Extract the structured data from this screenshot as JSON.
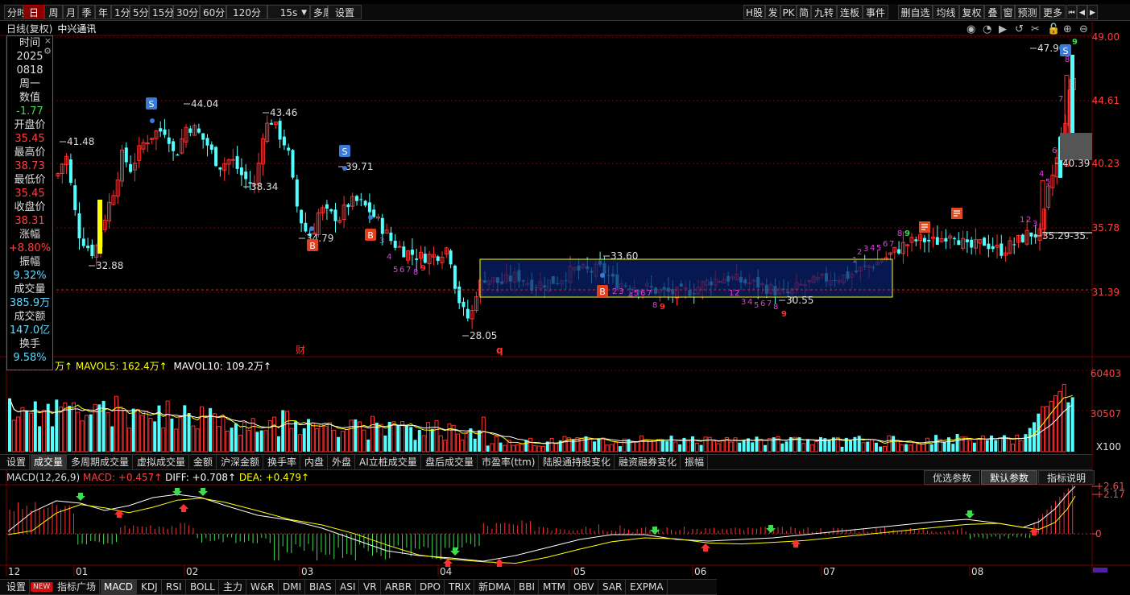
{
  "toolbar": {
    "left_items": [
      {
        "label": "分时",
        "active": false
      },
      {
        "label": "日",
        "active": true
      },
      {
        "label": "周",
        "active": false
      },
      {
        "label": "月",
        "active": false
      },
      {
        "label": "季",
        "active": false
      },
      {
        "label": "年",
        "active": false
      },
      {
        "label": "1分",
        "active": false
      },
      {
        "label": "5分",
        "active": false
      },
      {
        "label": "15分",
        "active": false
      },
      {
        "label": "30分",
        "active": false
      },
      {
        "label": "60分",
        "active": false
      },
      {
        "label": "120分",
        "active": false
      },
      {
        "label": "15s",
        "active": false
      },
      {
        "label": "多周期",
        "active": false
      },
      {
        "label": "设置",
        "active": false
      }
    ],
    "right_items": [
      "H股",
      "发",
      "PK",
      "简",
      "九转",
      "连板",
      "事件",
      "删自选",
      "均线",
      "复权",
      "叠",
      "窗",
      "预测",
      "更多"
    ]
  },
  "stock": {
    "period": "日线(复权)",
    "name": "中兴通讯"
  },
  "info_panel": {
    "rows": [
      {
        "label": "时间",
        "value": "2025",
        "cls": "lbl"
      },
      {
        "label": "",
        "value": "0818",
        "cls": "lbl"
      },
      {
        "label": "",
        "value": "周一",
        "cls": "lbl"
      },
      {
        "label": "数值",
        "value": "-1.77",
        "cls": "neg"
      },
      {
        "label": "开盘价",
        "value": "35.45",
        "cls": "pos"
      },
      {
        "label": "最高价",
        "value": "38.73",
        "cls": "pos"
      },
      {
        "label": "最低价",
        "value": "35.45",
        "cls": "pos"
      },
      {
        "label": "收盘价",
        "value": "38.31",
        "cls": "pos"
      },
      {
        "label": "涨幅",
        "value": "+8.80%",
        "cls": "pos"
      },
      {
        "label": "振幅",
        "value": "9.32%",
        "cls": "cyan"
      },
      {
        "label": "成交量",
        "value": "385.9万",
        "cls": "cyan"
      },
      {
        "label": "成交额",
        "value": "147.0亿",
        "cls": "cyan"
      },
      {
        "label": "换手",
        "value": "9.58%",
        "cls": "cyan"
      }
    ]
  },
  "price_axis": [
    "49.00",
    "44.61",
    "40.23",
    "35.78",
    "31.39"
  ],
  "price_annotations": [
    "41.48",
    "44.04",
    "43.46",
    "38.34",
    "39.71",
    "32.88",
    "34.79",
    "28.05",
    "33.60",
    "30.55",
    "47.90",
    "40.39",
    "35.29-35."
  ],
  "price_markers": {
    "s": "S",
    "b": "B",
    "cai": "财",
    "q": "q"
  },
  "volume_legend": {
    "vol": "万↑",
    "mavol5": "MAVOL5: 162.4万↑",
    "mavol10": "MAVOL10: 109.2万↑"
  },
  "volume_axis": [
    "60403",
    "30507",
    "X100"
  ],
  "volume_tabs": [
    "设置",
    "成交量",
    "多周期成交量",
    "虚拟成交量",
    "金额",
    "沪深金额",
    "换手率",
    "内盘",
    "外盘",
    "AI立桩成交量",
    "盘后成交量",
    "市盈率(ttm)",
    "陆股通持股变化",
    "融资融券变化",
    "振幅"
  ],
  "macd_legend": {
    "name": "MACD(12,26,9)",
    "macd": "MACD: +0.457↑",
    "diff": "DIFF: +0.708↑",
    "dea": "DEA: +0.479↑"
  },
  "macd_buttons": [
    "优选参数",
    "默认参数",
    "指标说明"
  ],
  "macd_axis": [
    "2.61",
    "2.17",
    "0"
  ],
  "date_axis": [
    "12",
    "01",
    "02",
    "03",
    "04",
    "05",
    "06",
    "07",
    "08"
  ],
  "indicator_tabs": [
    "设置",
    "NEW",
    "指标广场",
    "MACD",
    "KDJ",
    "RSI",
    "BOLL",
    "主力",
    "W&R",
    "DMI",
    "BIAS",
    "ASI",
    "VR",
    "ARBR",
    "DPO",
    "TRIX",
    "新DMA",
    "BBI",
    "MTM",
    "OBV",
    "SAR",
    "EXPMA"
  ],
  "colors": {
    "up": "#ff3030",
    "down": "#54ffff",
    "bg": "#000000",
    "grid": "#7a0000",
    "macd_diff": "#ffffff",
    "macd_dea": "#ffff00",
    "box": "#ffff00"
  }
}
